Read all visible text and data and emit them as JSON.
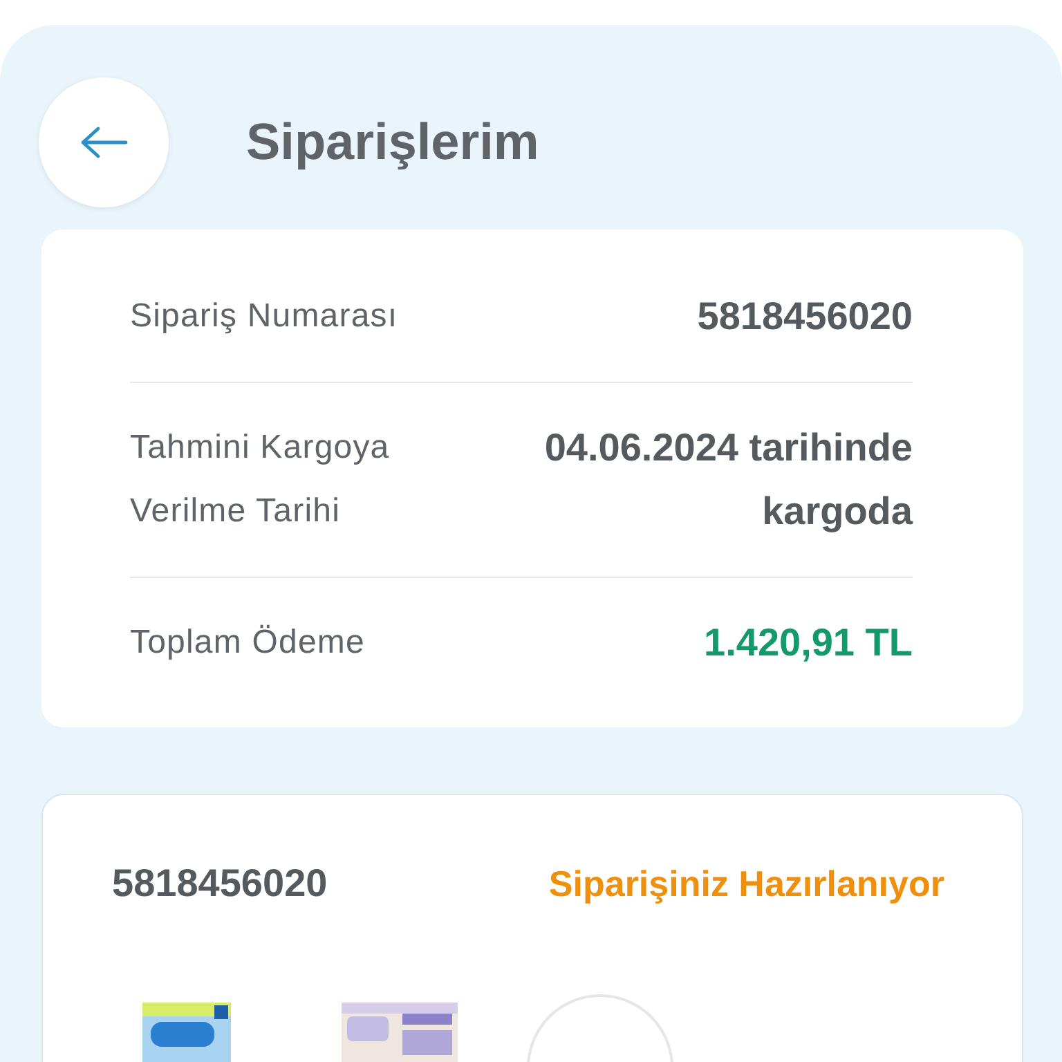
{
  "header": {
    "title": "Siparişlerim"
  },
  "summary": [
    {
      "label": "Sipariş Numarası",
      "value": "5818456020",
      "kind": "plain"
    },
    {
      "label": "Tahmini Kargoya Verilme Tarihi",
      "value": "04.06.2024 tarihinde kargoda",
      "kind": "plain"
    },
    {
      "label": "Toplam Ödeme",
      "value": "1.420,91 TL",
      "kind": "amount"
    }
  ],
  "order": {
    "number": "5818456020",
    "status": {
      "text": "Siparişiniz Hazırlanıyor",
      "kind": "preparing"
    }
  }
}
